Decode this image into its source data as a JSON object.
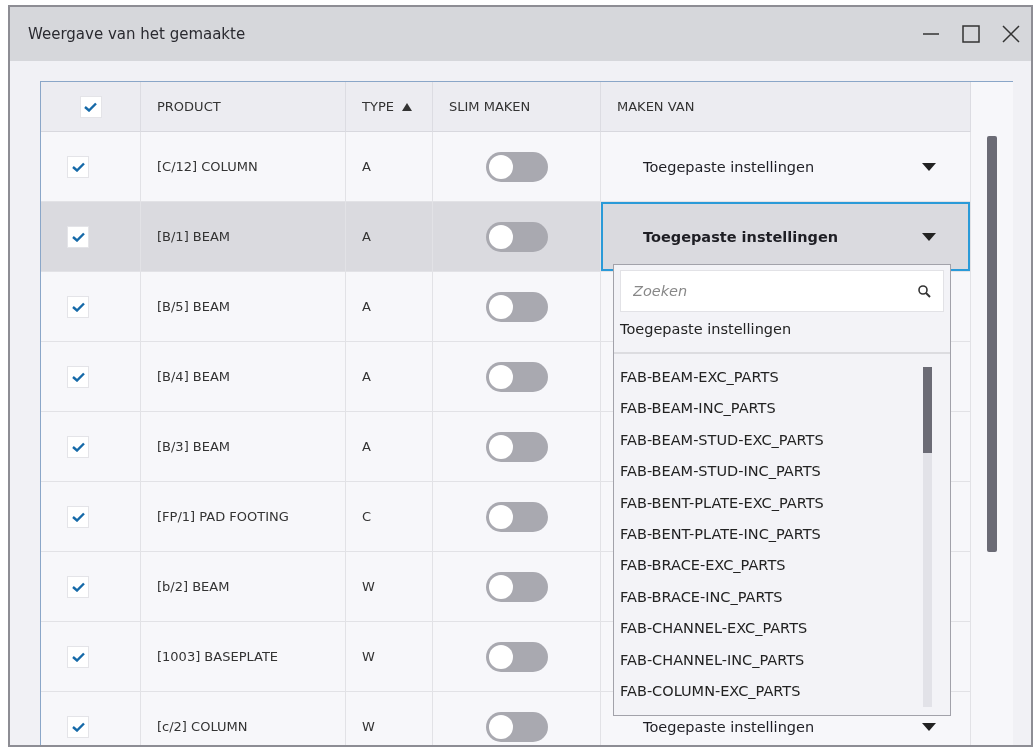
{
  "window": {
    "title": "Weergave van het gemaakte"
  },
  "table": {
    "all_checked": true,
    "columns": [
      {
        "label": "PRODUCT",
        "sorted": false
      },
      {
        "label": "TYPE",
        "sorted": true
      },
      {
        "label": "SLIM MAKEN",
        "sorted": false
      },
      {
        "label": "MAKEN VAN",
        "sorted": false
      }
    ],
    "rows": [
      {
        "checked": true,
        "product": "[C/12] COLUMN",
        "type": "A",
        "smart": false,
        "maken_van": "Toegepaste instellingen",
        "selected": false
      },
      {
        "checked": true,
        "product": "[B/1] BEAM",
        "type": "A",
        "smart": false,
        "maken_van": "Toegepaste instellingen",
        "selected": true
      },
      {
        "checked": true,
        "product": "[B/5] BEAM",
        "type": "A",
        "smart": false,
        "selected": false
      },
      {
        "checked": true,
        "product": "[B/4] BEAM",
        "type": "A",
        "smart": false,
        "selected": false
      },
      {
        "checked": true,
        "product": "[B/3] BEAM",
        "type": "A",
        "smart": false,
        "selected": false
      },
      {
        "checked": true,
        "product": "[FP/1] PAD FOOTING",
        "type": "C",
        "smart": false,
        "selected": false
      },
      {
        "checked": true,
        "product": "[b/2] BEAM",
        "type": "W",
        "smart": false,
        "selected": false
      },
      {
        "checked": true,
        "product": "[1003] BASEPLATE",
        "type": "W",
        "smart": false,
        "selected": false
      },
      {
        "checked": true,
        "product": "[c/2] COLUMN",
        "type": "W",
        "smart": false,
        "maken_van": "Toegepaste instellingen",
        "selected": false
      }
    ]
  },
  "dropdown": {
    "search_placeholder": "Zoeken",
    "current": "Toegepaste instellingen",
    "options": [
      "FAB-BEAM-EXC_PARTS",
      "FAB-BEAM-INC_PARTS",
      "FAB-BEAM-STUD-EXC_PARTS",
      "FAB-BEAM-STUD-INC_PARTS",
      "FAB-BENT-PLATE-EXC_PARTS",
      "FAB-BENT-PLATE-INC_PARTS",
      "FAB-BRACE-EXC_PARTS",
      "FAB-BRACE-INC_PARTS",
      "FAB-CHANNEL-EXC_PARTS",
      "FAB-CHANNEL-INC_PARTS",
      "FAB-COLUMN-EXC_PARTS"
    ]
  }
}
